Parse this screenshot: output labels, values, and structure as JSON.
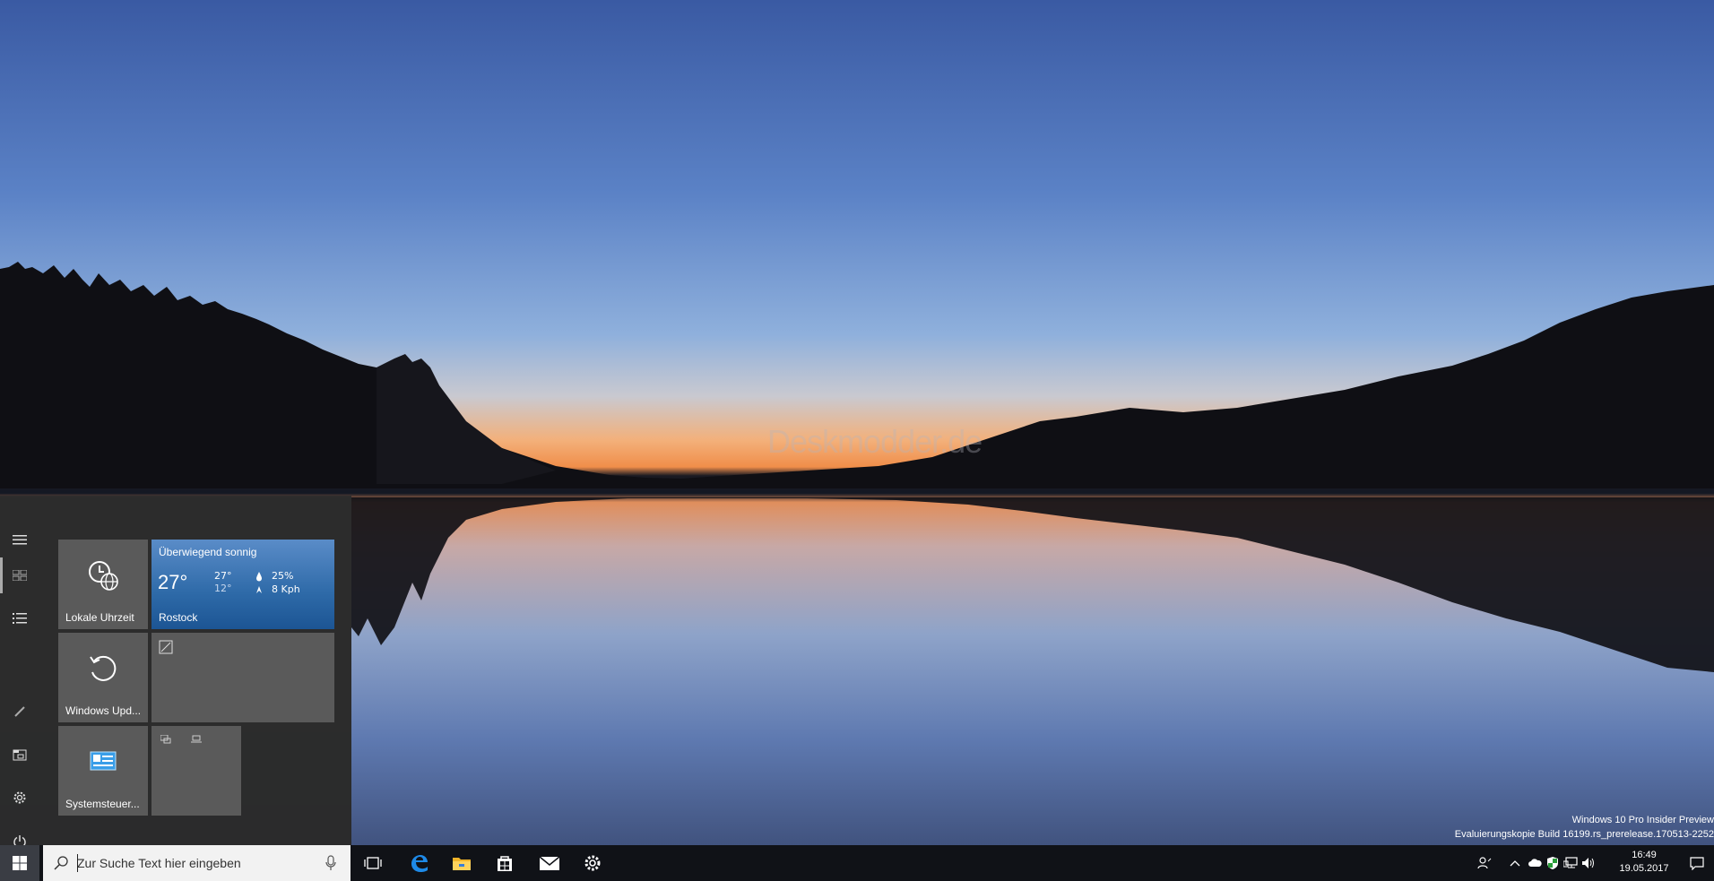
{
  "watermark": "Deskmodder.de",
  "start_menu": {
    "rail": [
      "hamburger-icon",
      "tiles-icon",
      "list-icon",
      "pen-icon",
      "explorer-icon",
      "gear-icon",
      "power-icon"
    ],
    "tiles": {
      "clock": {
        "label": "Lokale Uhrzeit"
      },
      "weather": {
        "condition": "Überwiegend sonnig",
        "temp": "27°",
        "hi": "27°",
        "lo": "12°",
        "rain": "25%",
        "wind": "8 Kph",
        "city": "Rostock"
      },
      "update": {
        "label": "Windows Upd..."
      },
      "control_panel": {
        "label": "Systemsteuer..."
      }
    }
  },
  "taskbar": {
    "search_placeholder": "Zur Suche Text hier eingeben",
    "pinned": [
      "task-view-icon",
      "edge-icon",
      "explorer-icon",
      "store-icon",
      "mail-icon",
      "settings-icon"
    ],
    "clock": {
      "time": "16:49",
      "date": "19.05.2017"
    }
  },
  "eval": {
    "line1": "Windows 10 Pro Insider Preview",
    "line2": "Evaluierungskopie Build 16199.rs_prerelease.170513-2252"
  },
  "colors": {
    "accent": "#2e6aa8",
    "taskbar": "#101217",
    "start_bg": "#2d2d2d"
  }
}
